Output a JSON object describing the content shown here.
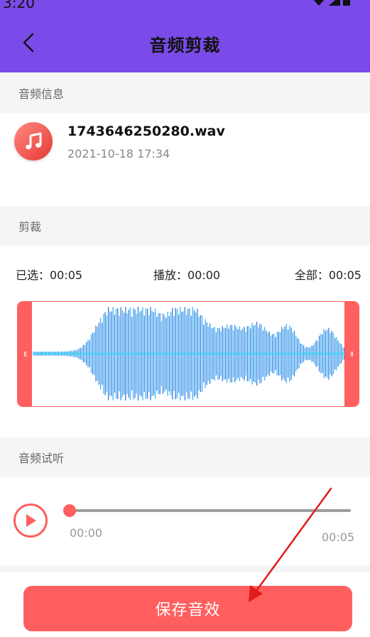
{
  "colors": {
    "accent": "#7a4be8",
    "coral": "#ff5f5f",
    "wave_blue": "#1ea7f5",
    "annotation_arrow": "#e21b1b"
  },
  "status_bar": {
    "time": "3:20",
    "icons": [
      "wifi-icon",
      "signal-icon",
      "battery-icon"
    ]
  },
  "header": {
    "back_icon": "back-chevron-icon",
    "title": "音频剪裁"
  },
  "audio_info": {
    "section_label": "音频信息",
    "file_icon": "music-note-icon",
    "file_name": "1743646250280.wav",
    "date": "2021-10-18 17:34"
  },
  "trim": {
    "section_label": "剪裁",
    "selected": "已选：00:05",
    "playing": "播放：00:00",
    "total": "全部：00:05",
    "handle_grip_icon": "grip-icon"
  },
  "preview": {
    "section_label": "音频试听",
    "play_icon": "play-icon",
    "progress_fraction": 0,
    "current_time": "00:00",
    "end_time": "00:05"
  },
  "actions": {
    "save_label": "保存音效"
  }
}
